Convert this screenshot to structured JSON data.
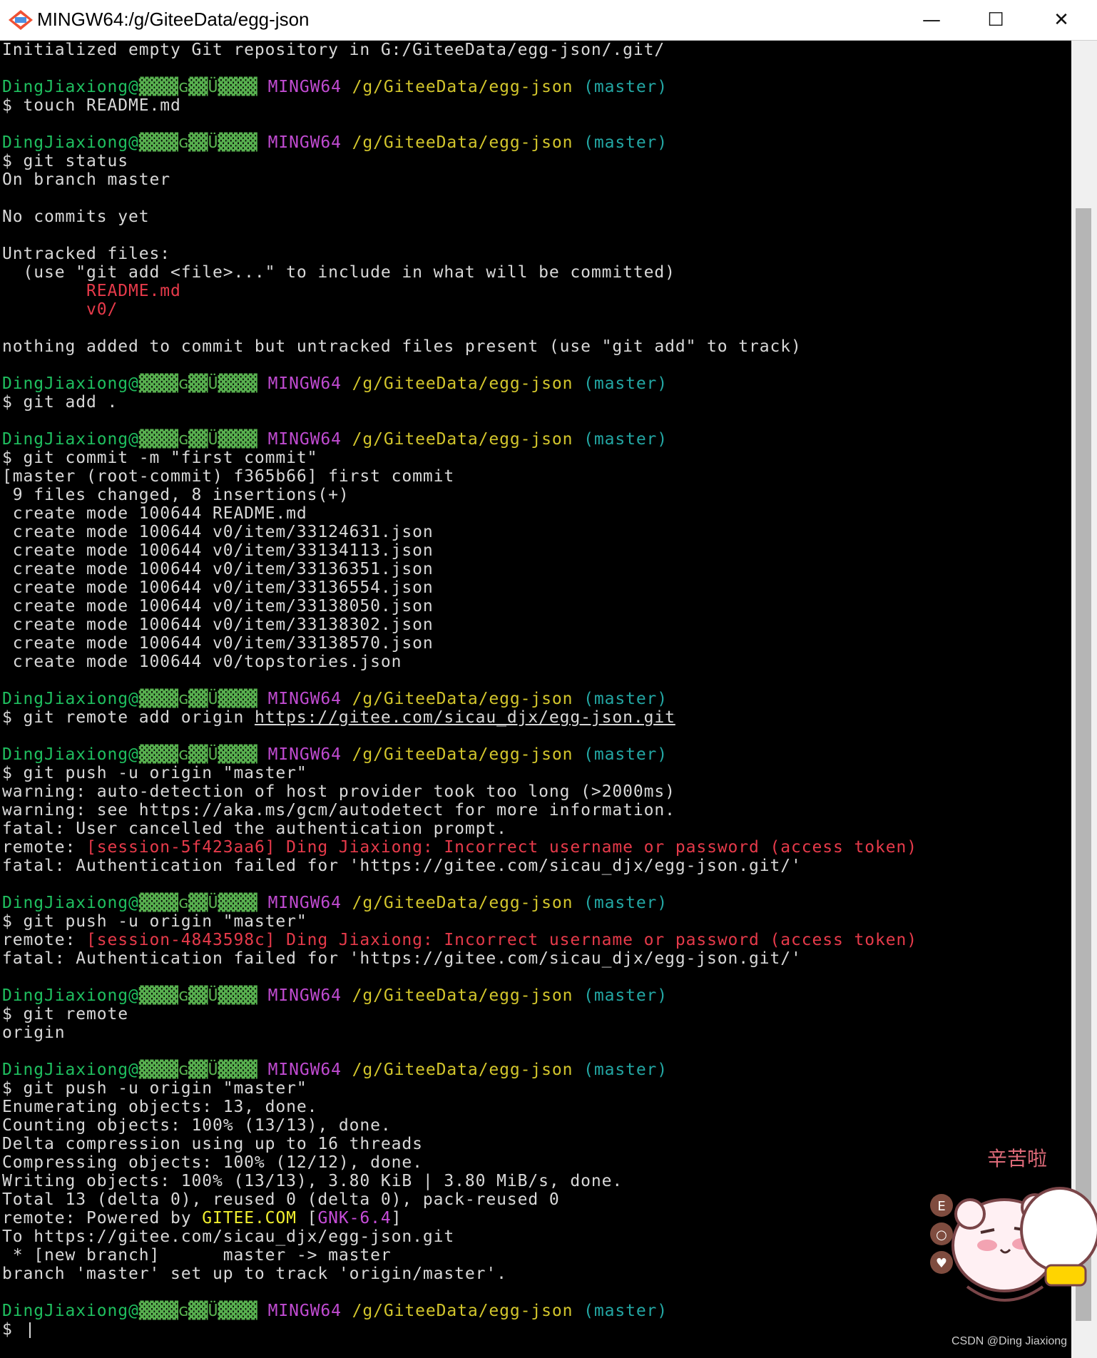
{
  "window": {
    "title": "MINGW64:/g/GiteeData/egg-json",
    "minimize": "—",
    "maximize": "☐",
    "close": "✕",
    "icons": {
      "app": "git-bash-icon"
    }
  },
  "prompt": {
    "user": "DingJiaxiong@",
    "masked": "▓▓▓▓ɢ▓▓Ü▓▓▓▓",
    "shell": "MINGW64",
    "path": "/g/GiteeData/egg-json",
    "branch": "(master)"
  },
  "terminal": {
    "init_line": "Initialized empty Git repository in G:/GiteeData/egg-json/.git/",
    "cmd_touch": "$ touch README.md",
    "cmd_status": "$ git status",
    "on_branch": "On branch master",
    "no_commits": "No commits yet",
    "untracked_files": "Untracked files:",
    "use_git_add": "  (use \"git add <file>...\" to include in what will be committed)",
    "untracked_readme": "        README.md",
    "untracked_v0": "        v0/",
    "nothing_added": "nothing added to commit but untracked files present (use \"git add\" to track)",
    "cmd_add": "$ git add .",
    "cmd_commit": "$ git commit -m \"first commit\"",
    "commit_result": "[master (root-commit) f365b66] first commit",
    "files_changed": " 9 files changed, 8 insertions(+)",
    "create_lines": [
      " create mode 100644 README.md",
      " create mode 100644 v0/item/33124631.json",
      " create mode 100644 v0/item/33134113.json",
      " create mode 100644 v0/item/33136351.json",
      " create mode 100644 v0/item/33136554.json",
      " create mode 100644 v0/item/33138050.json",
      " create mode 100644 v0/item/33138302.json",
      " create mode 100644 v0/item/33138570.json",
      " create mode 100644 v0/topstories.json"
    ],
    "cmd_remote_add_prefix": "$ git remote add origin ",
    "remote_url": "https://gitee.com/sicau_djx/egg-json.git",
    "cmd_push": "$ git push -u origin \"master\"",
    "warn_autodetect": "warning: auto-detection of host provider took too long (>2000ms)",
    "warn_see": "warning: see https://aka.ms/gcm/autodetect for more information.",
    "fatal_cancelled": "fatal: User cancelled the authentication prompt.",
    "remote_prefix": "remote: ",
    "session_err_1": "[session-5f423aa6] Ding Jiaxiong: Incorrect username or password (access token)",
    "fatal_auth_failed": "fatal: Authentication failed for 'https://gitee.com/sicau_djx/egg-json.git/'",
    "session_err_2": "[session-4843598c] Ding Jiaxiong: Incorrect username or password (access token)",
    "cmd_remote": "$ git remote",
    "remote_origin": "origin",
    "enumerating": "Enumerating objects: 13, done.",
    "counting": "Counting objects: 100% (13/13), done.",
    "delta": "Delta compression using up to 16 threads",
    "compressing": "Compressing objects: 100% (12/12), done.",
    "writing": "Writing objects: 100% (13/13), 3.80 KiB | 3.80 MiB/s, done.",
    "total": "Total 13 (delta 0), reused 0 (delta 0), pack-reused 0",
    "powered_prefix": "remote: Powered by ",
    "gitee": "GITEE.COM",
    "gnk_open": " [",
    "gnk": "GNK-6.4",
    "gnk_close": "]",
    "to_url": "To https://gitee.com/sicau_djx/egg-json.git",
    "new_branch": " * [new branch]      master -> master",
    "track": "branch 'master' set up to track 'origin/master'.",
    "final_prompt": "$ "
  },
  "sticker": {
    "caption": "辛苦啦",
    "badges": [
      "E",
      "○",
      "♥"
    ]
  },
  "watermark": "CSDN @Ding Jiaxiong"
}
